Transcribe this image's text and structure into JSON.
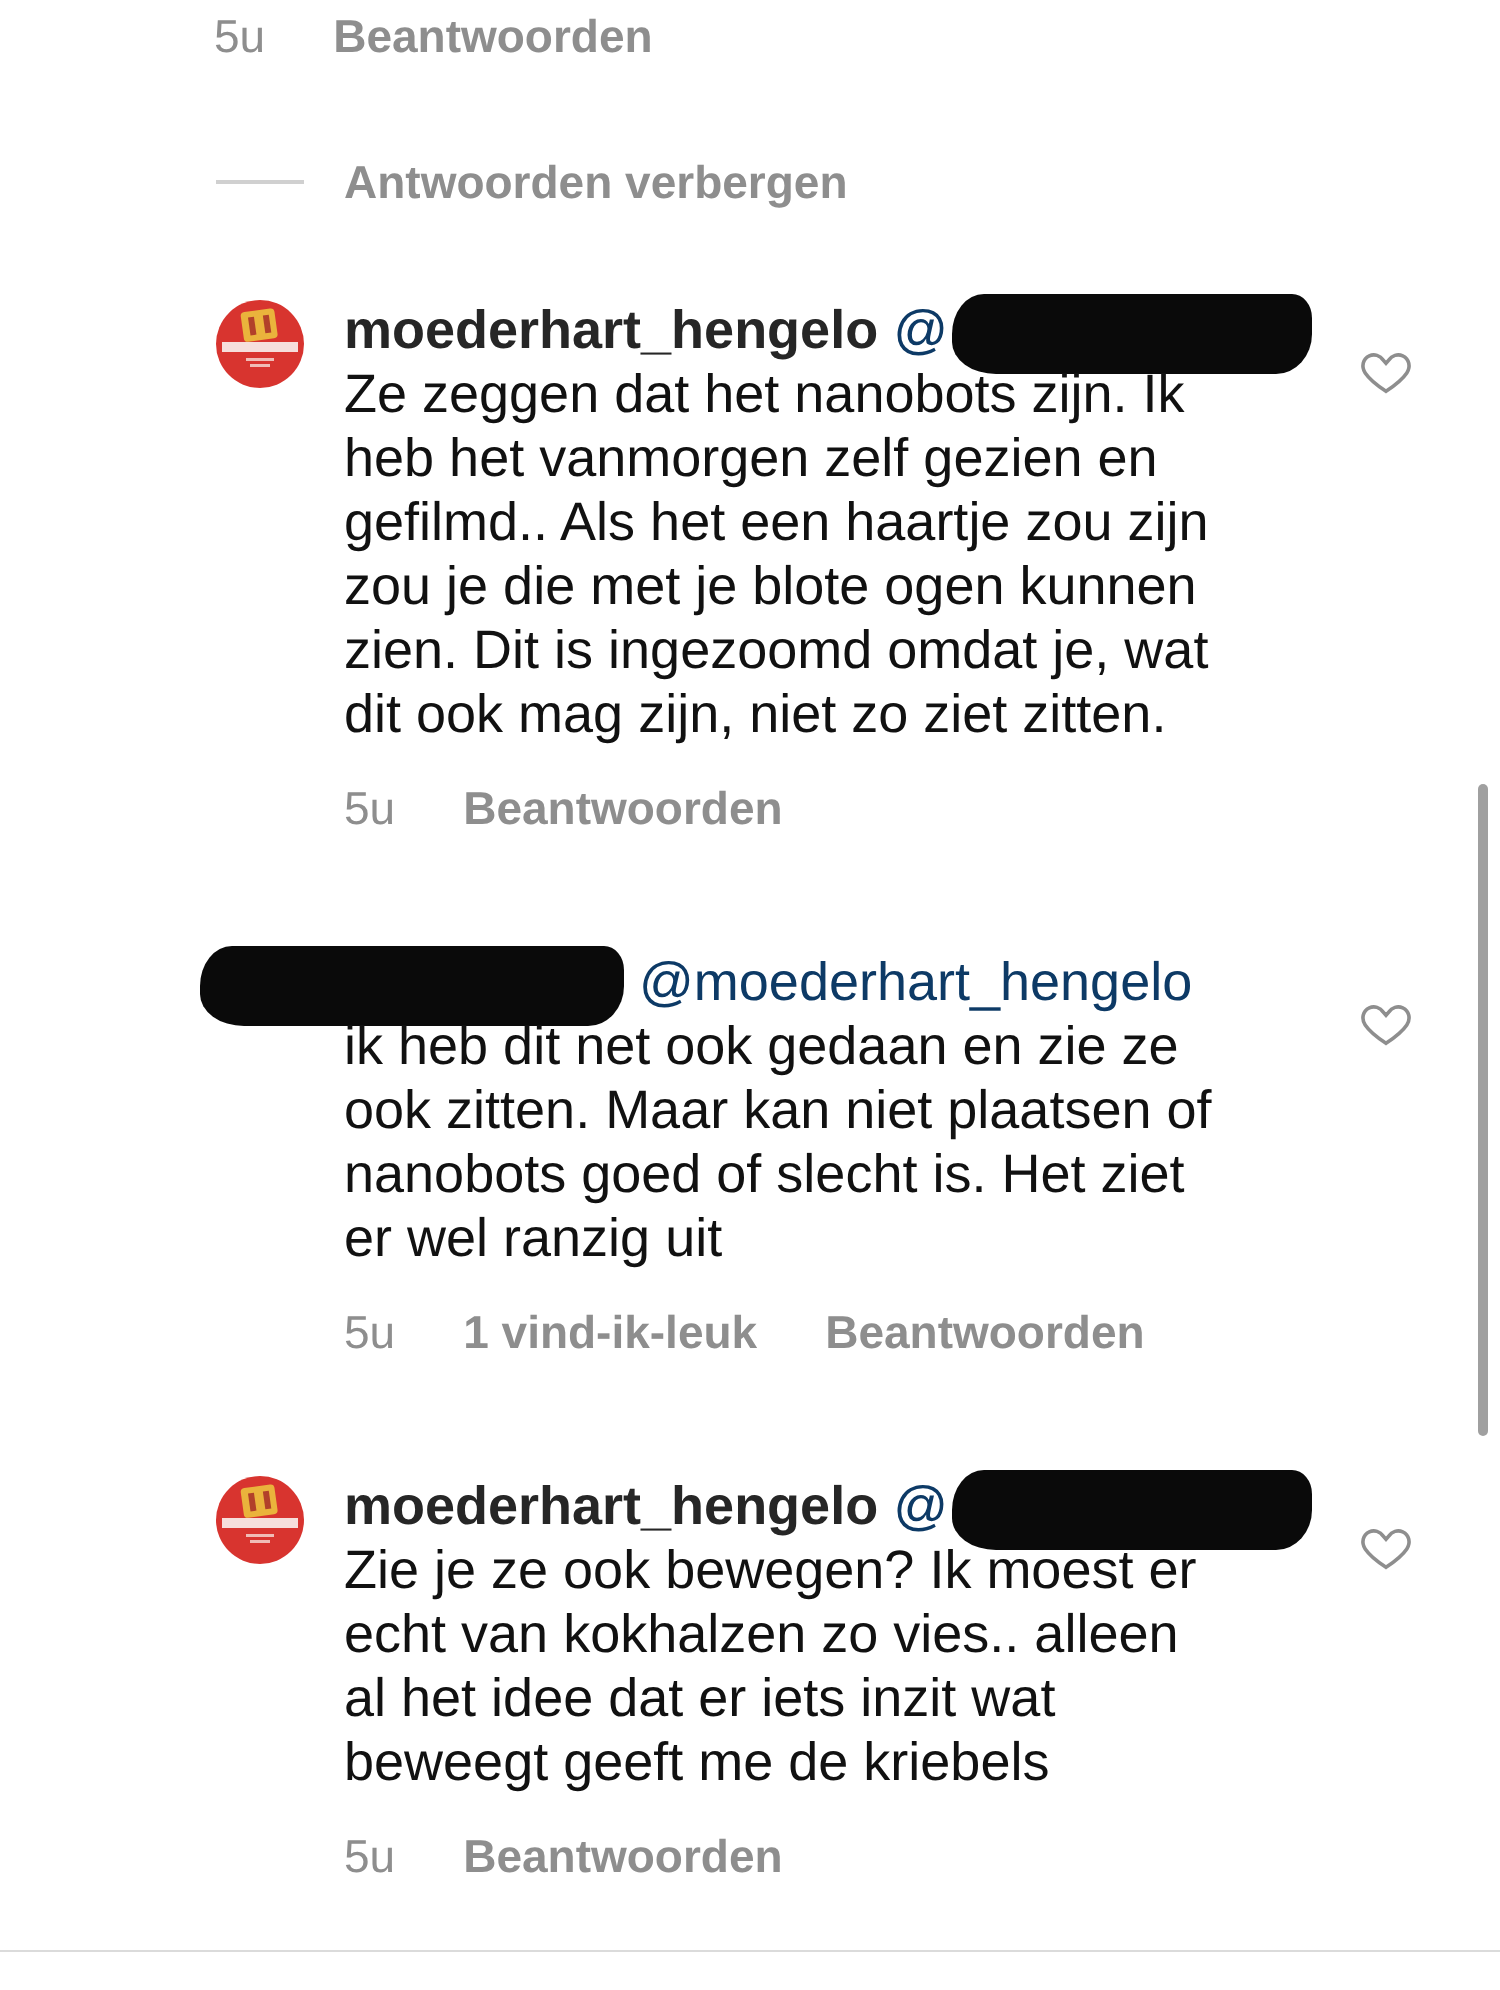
{
  "parent_meta": {
    "time": "5u",
    "reply_label": "Beantwoorden"
  },
  "hide_replies": {
    "label": "Antwoorden verbergen"
  },
  "replies": [
    {
      "avatar": {
        "kind": "logo"
      },
      "author_redacted": false,
      "author": "moederhart_hengelo",
      "mention": "@",
      "mention_redacted": true,
      "text": "Ze zeggen dat het nanobots zijn. Ik heb het vanmorgen zelf gezien en gefilmd.. Als het een haartje zou zijn zou je die met je blote ogen kunnen zien. Dit is ingezoomd omdat je, wat dit ook mag zijn, niet zo ziet zitten.",
      "liked": false,
      "time": "5u",
      "reply_label": "Beantwoorden"
    },
    {
      "author_redacted": true,
      "mention": "@moederhart_hengelo",
      "mention_redacted": false,
      "text": "ik heb dit net ook gedaan en zie ze ook zitten. Maar kan niet plaatsen of nanobots goed of slecht is. Het ziet er wel ranzig uit",
      "liked": false,
      "time": "5u",
      "likes": "1 vind-ik-leuk",
      "reply_label": "Beantwoorden"
    },
    {
      "avatar": {
        "kind": "logo"
      },
      "author_redacted": false,
      "author": "moederhart_hengelo",
      "mention": "@",
      "mention_redacted": true,
      "text": "Zie je ze ook bewegen? Ik moest er echt van kokhalzen zo vies.. alleen al het idee dat er iets inzit wat beweegt geeft me de kriebels",
      "liked": false,
      "time": "5u",
      "reply_label": "Beantwoorden"
    }
  ]
}
